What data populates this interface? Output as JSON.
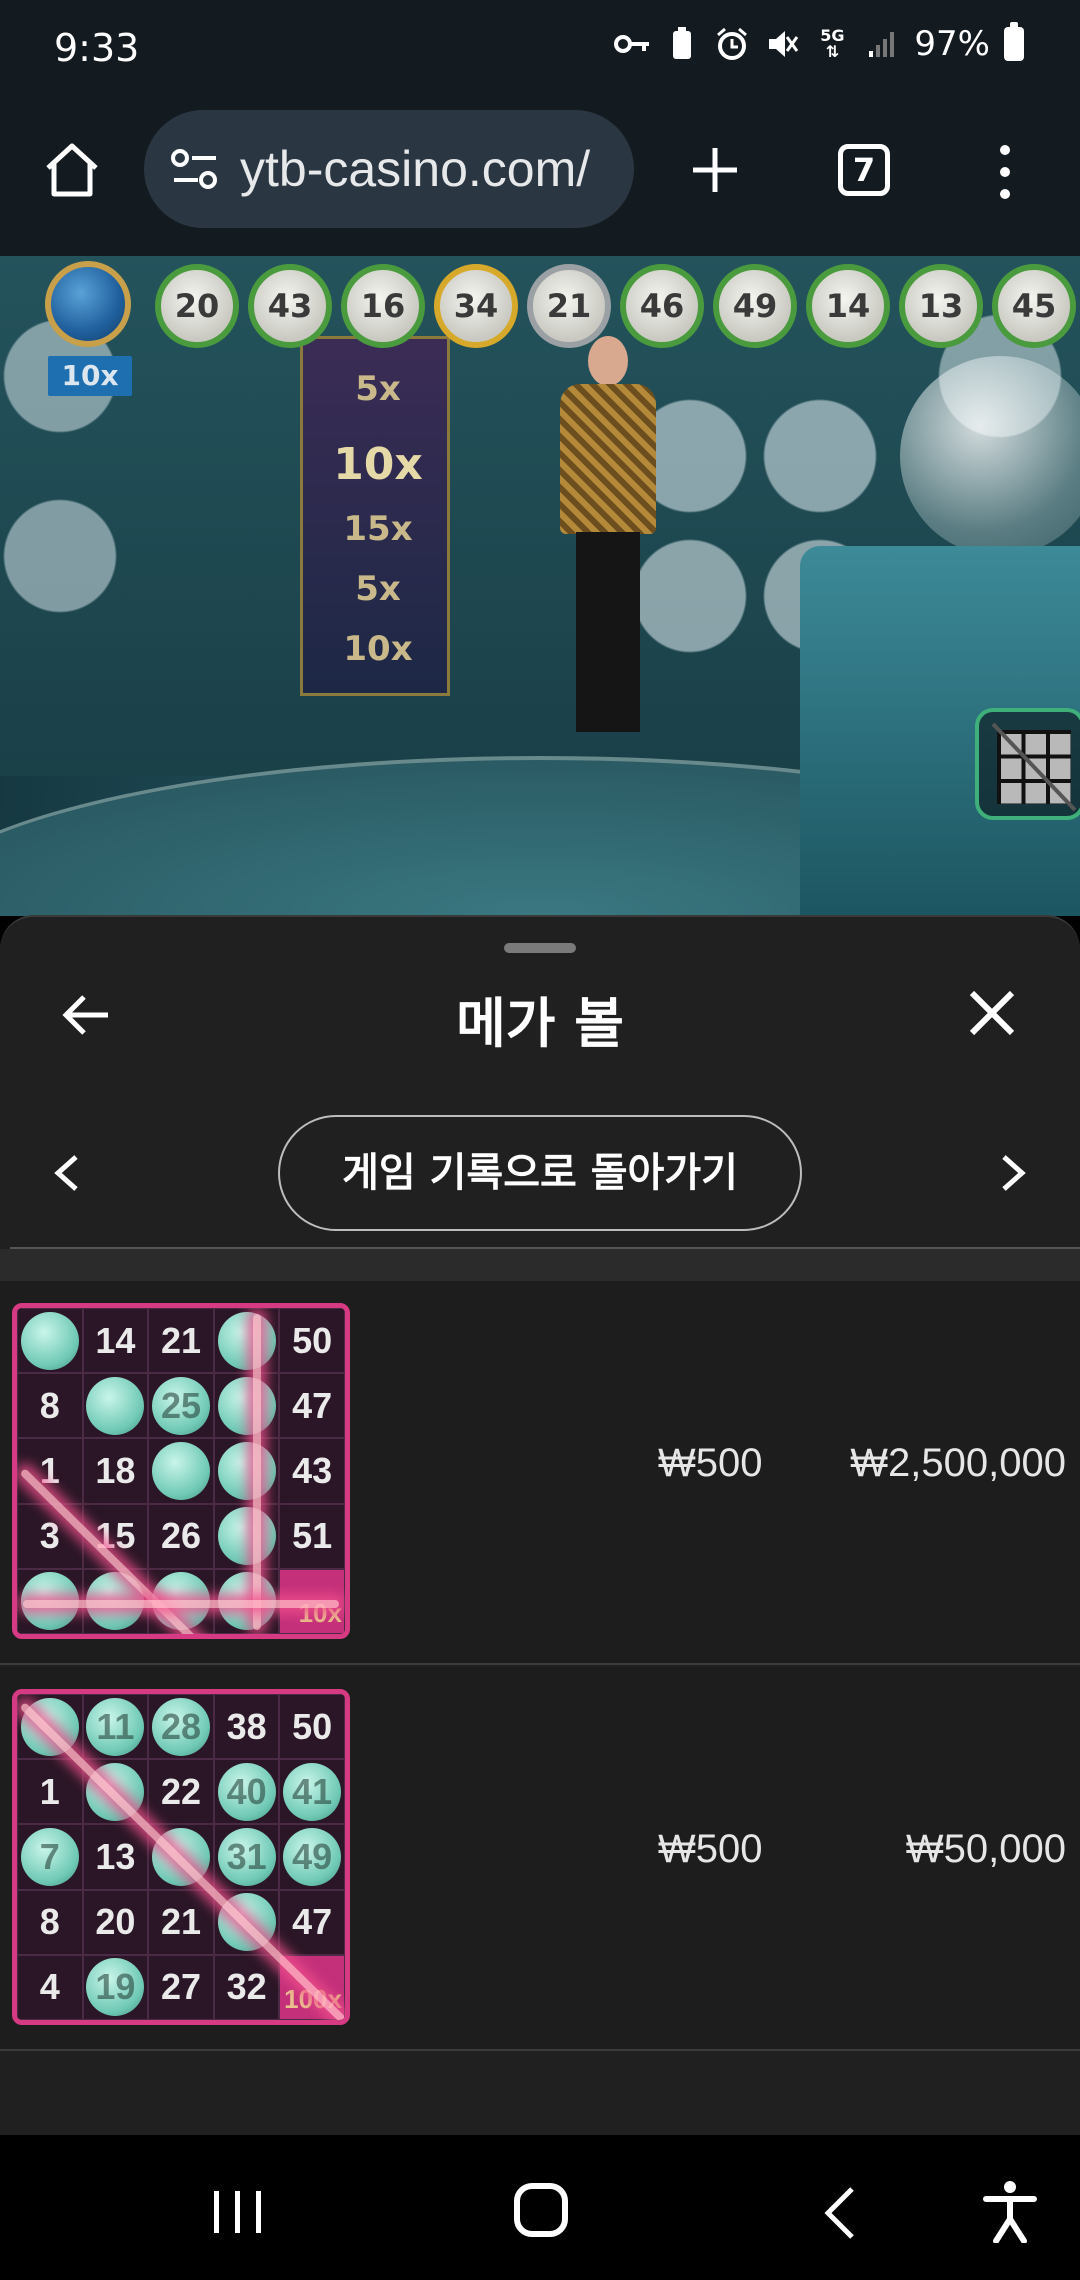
{
  "status_bar": {
    "time": "9:33",
    "network": "5G",
    "battery": "97%"
  },
  "browser": {
    "url": "ytb-casino.com/",
    "tab_count": "7"
  },
  "video": {
    "mega_multiplier": "10x",
    "drawn_balls": [
      {
        "number": "20",
        "ring": "green"
      },
      {
        "number": "43",
        "ring": "green"
      },
      {
        "number": "16",
        "ring": "green"
      },
      {
        "number": "34",
        "ring": "gold"
      },
      {
        "number": "21",
        "ring": "silver"
      },
      {
        "number": "46",
        "ring": "green"
      },
      {
        "number": "49",
        "ring": "green"
      },
      {
        "number": "14",
        "ring": "green"
      },
      {
        "number": "13",
        "ring": "green"
      },
      {
        "number": "45",
        "ring": "green"
      }
    ],
    "wheel_labels": [
      "5x",
      "10x",
      "15x",
      "5x",
      "10x"
    ]
  },
  "sheet": {
    "title": "메가 볼",
    "back_to_history": "게임 기록으로 돌아가기"
  },
  "cards": [
    {
      "bet": "₩500",
      "win": "₩2,500,000",
      "cells": [
        [
          "",
          "14",
          "21",
          "",
          "50"
        ],
        [
          "8",
          "",
          "25",
          "",
          "47"
        ],
        [
          "1",
          "18",
          "",
          "",
          "43"
        ],
        [
          "3",
          "15",
          "26",
          "",
          "51"
        ],
        [
          "",
          "",
          "",
          "",
          "10x"
        ]
      ],
      "marked": [
        [
          0,
          0
        ],
        [
          1,
          1
        ],
        [
          1,
          2
        ],
        [
          2,
          2
        ],
        [
          0,
          3
        ],
        [
          1,
          3
        ],
        [
          2,
          3
        ],
        [
          3,
          3
        ],
        [
          4,
          0
        ],
        [
          4,
          1
        ],
        [
          4,
          2
        ],
        [
          4,
          3
        ]
      ]
    },
    {
      "bet": "₩500",
      "win": "₩50,000",
      "cells": [
        [
          "",
          "11",
          "28",
          "38",
          "50"
        ],
        [
          "1",
          "",
          "22",
          "40",
          "41"
        ],
        [
          "7",
          "13",
          "",
          "31",
          "49"
        ],
        [
          "8",
          "20",
          "21",
          "",
          "47"
        ],
        [
          "4",
          "19",
          "27",
          "32",
          "100x"
        ]
      ],
      "marked": [
        [
          0,
          0
        ],
        [
          0,
          1
        ],
        [
          0,
          2
        ],
        [
          1,
          1
        ],
        [
          1,
          3
        ],
        [
          1,
          4
        ],
        [
          2,
          0
        ],
        [
          2,
          2
        ],
        [
          2,
          3
        ],
        [
          2,
          4
        ],
        [
          3,
          3
        ],
        [
          4,
          1
        ]
      ]
    }
  ],
  "colors": {
    "card_border": "#d63a82",
    "marked_ball": "#6fc9b5",
    "accent_green": "#3fb07a"
  }
}
